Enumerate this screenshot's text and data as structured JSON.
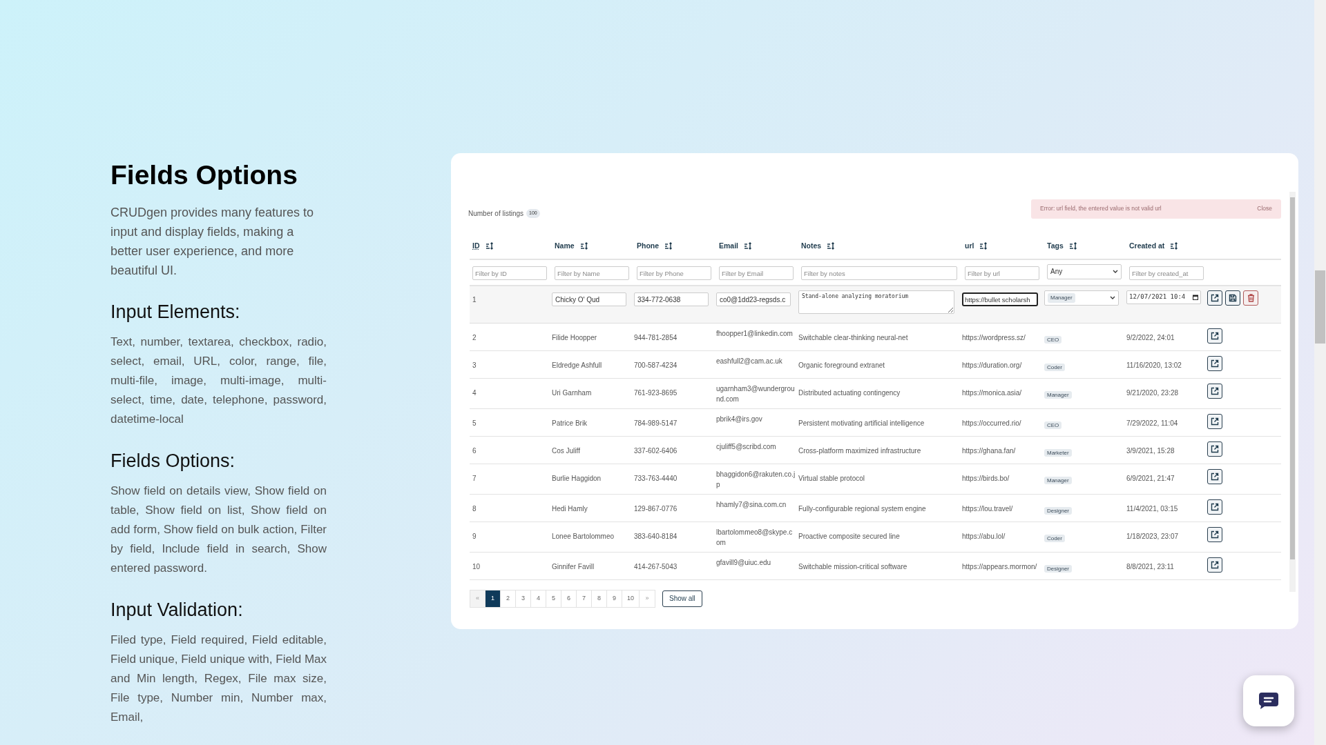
{
  "intro": {
    "title": "Fields Options",
    "text": "CRUDgen provides many features to input and display fields, making a better user experience, and more beautiful UI."
  },
  "sections": [
    {
      "heading": "Input Elements:",
      "text": "Text, number, textarea, checkbox, radio, select, email, URL, color, range, file, multi-file, image, multi-image, multi-select, time, date, telephone, password, datetime-local"
    },
    {
      "heading": "Fields Options:",
      "text": "Show field on details view, Show field on table, Show field on list, Show field on add form, Show field on bulk action, Filter by field, Include field in search, Show entered password."
    },
    {
      "heading": "Input Validation:",
      "text": "Filed type, Field required, Field editable, Field unique, Field unique with, Field Max and Min length, Regex, File max size, File type, Number min, Number max, Email,"
    }
  ],
  "listing": {
    "count_label": "Number of listings",
    "count": "100",
    "alert": {
      "message": "Error: url field, the entered value is not valid url",
      "close": "Close"
    },
    "columns": [
      {
        "label": "ID",
        "selected": true
      },
      {
        "label": "Name",
        "selected": false
      },
      {
        "label": "Phone",
        "selected": false
      },
      {
        "label": "Email",
        "selected": false
      },
      {
        "label": "Notes",
        "selected": false
      },
      {
        "label": "url",
        "selected": false
      },
      {
        "label": "Tags",
        "selected": false
      },
      {
        "label": "Created at",
        "selected": false
      }
    ],
    "filters": [
      {
        "kind": "text",
        "placeholder": "Filter by ID"
      },
      {
        "kind": "text",
        "placeholder": "Filter by Name"
      },
      {
        "kind": "text",
        "placeholder": "Filter by Phone"
      },
      {
        "kind": "text",
        "placeholder": "Filter by Email"
      },
      {
        "kind": "text",
        "placeholder": "Filter by notes"
      },
      {
        "kind": "text",
        "placeholder": "Filter by url"
      },
      {
        "kind": "select",
        "value": "Any"
      },
      {
        "kind": "text",
        "placeholder": "Filter by created_at"
      }
    ],
    "rows": [
      {
        "kind": "edit",
        "id": "1",
        "name": "Chicky O' Qud",
        "phone": "334-772-0638",
        "email": "co0@1dd23-regsds.c",
        "notes": "Stand-alone analyzing moratorium",
        "url": "https://bullet scholarsh",
        "tag": "Manager",
        "created_at": "12/07/2021 10:4"
      },
      {
        "kind": "view",
        "id": "2",
        "name": "Filide Hoopper",
        "phone": "944-781-2854",
        "email": "fhoopper1@linkedin.com",
        "notes": "Switchable clear-thinking neural-net",
        "url": "https://wordpress.sz/",
        "tag": "CEO",
        "created_at": "9/2/2022, 24:01"
      },
      {
        "kind": "view",
        "id": "3",
        "name": "Eldredge Ashfull",
        "phone": "700-587-4234",
        "email": "eashfull2@cam.ac.uk",
        "notes": "Organic foreground extranet",
        "url": "https://duration.org/",
        "tag": "Coder",
        "created_at": "11/16/2020, 13:02"
      },
      {
        "kind": "view",
        "id": "4",
        "name": "Uri Garnham",
        "phone": "761-923-8695",
        "email": "ugarnham3@wunderground.com",
        "notes": "Distributed actuating contingency",
        "url": "https://monica.asia/",
        "tag": "Manager",
        "created_at": "9/21/2020, 23:28"
      },
      {
        "kind": "view",
        "id": "5",
        "name": "Patrice Brik",
        "phone": "784-989-5147",
        "email": "pbrik4@irs.gov",
        "notes": "Persistent motivating artificial intelligence",
        "url": "https://occurred.rio/",
        "tag": "CEO",
        "created_at": "7/29/2022, 11:04"
      },
      {
        "kind": "view",
        "id": "6",
        "name": "Cos Juliff",
        "phone": "337-602-6406",
        "email": "cjuliff5@scribd.com",
        "notes": "Cross-platform maximized infrastructure",
        "url": "https://ghana.fan/",
        "tag": "Marketer",
        "created_at": "3/9/2021, 15:28"
      },
      {
        "kind": "view",
        "id": "7",
        "name": "Burlie Haggidon",
        "phone": "733-763-4440",
        "email": "bhaggidon6@rakuten.co.jp",
        "notes": "Virtual stable protocol",
        "url": "https://birds.bo/",
        "tag": "Manager",
        "created_at": "6/9/2021, 21:47"
      },
      {
        "kind": "view",
        "id": "8",
        "name": "Hedi Hamly",
        "phone": "129-867-0776",
        "email": "hhamly7@sina.com.cn",
        "notes": "Fully-configurable regional system engine",
        "url": "https://lou.travel/",
        "tag": "Designer",
        "created_at": "11/4/2021, 03:15"
      },
      {
        "kind": "view",
        "id": "9",
        "name": "Lonee Bartolommeo",
        "phone": "383-640-8184",
        "email": "lbartolommeo8@skype.com",
        "notes": "Proactive composite secured line",
        "url": "https://abu.lol/",
        "tag": "Coder",
        "created_at": "1/18/2023, 23:07"
      },
      {
        "kind": "view",
        "id": "10",
        "name": "Ginnifer Favill",
        "phone": "414-267-5043",
        "email": "gfavill9@uiuc.edu",
        "notes": "Switchable mission-critical software",
        "url": "https://appears.mormon/",
        "tag": "Designer",
        "created_at": "8/8/2021, 23:11"
      }
    ],
    "pagination": {
      "prev": "«",
      "next": "»",
      "pages": [
        {
          "label": "1",
          "selected": true
        },
        {
          "label": "2",
          "selected": false
        },
        {
          "label": "3",
          "selected": false
        },
        {
          "label": "4",
          "selected": false
        },
        {
          "label": "5",
          "selected": false
        },
        {
          "label": "6",
          "selected": false
        },
        {
          "label": "7",
          "selected": false
        },
        {
          "label": "8",
          "selected": false
        },
        {
          "label": "9",
          "selected": false
        },
        {
          "label": "10",
          "selected": false
        }
      ]
    },
    "show_all": "Show all"
  }
}
